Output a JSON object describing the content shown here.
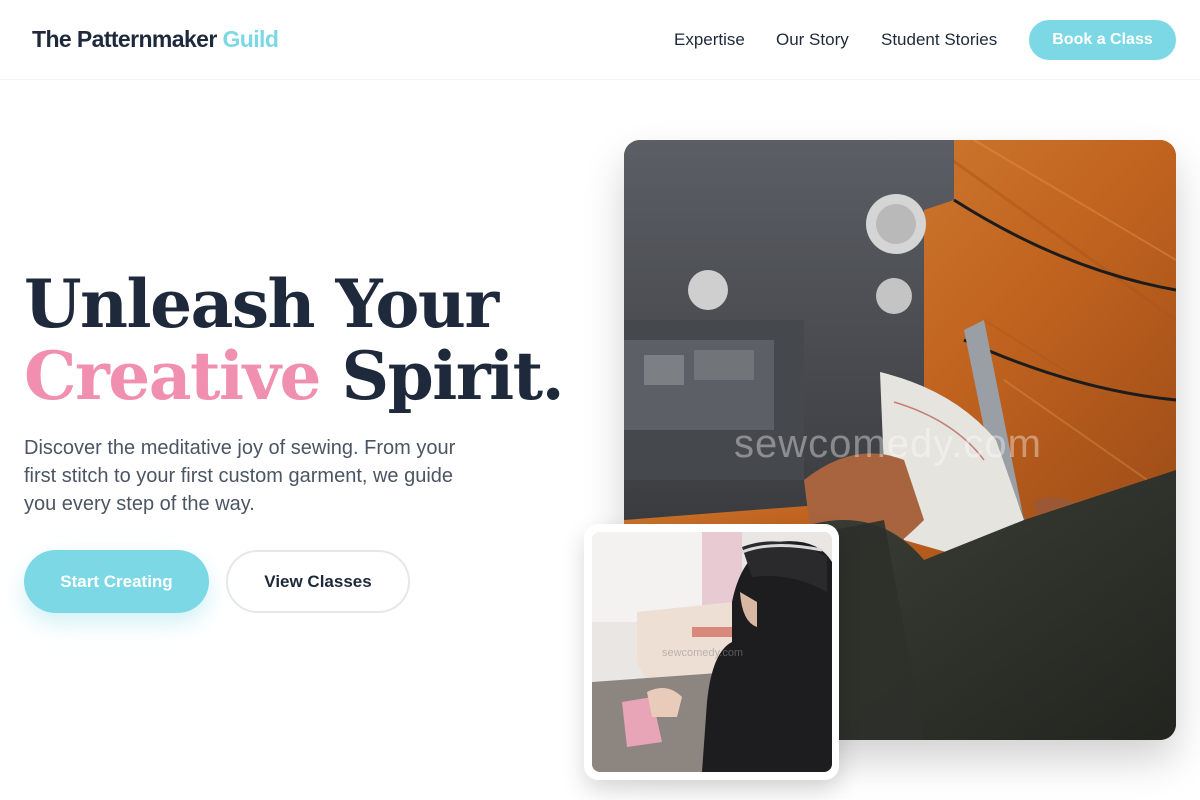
{
  "header": {
    "logo_main": "The Patternmaker",
    "logo_accent": "Guild",
    "nav": {
      "expertise": "Expertise",
      "story": "Our Story",
      "students": "Student Stories"
    },
    "cta": "Book a Class"
  },
  "hero": {
    "headline_line1": "Unleash Your",
    "headline_pink": "Creative",
    "headline_rest": "Spirit.",
    "subtext": "Discover the meditative joy of sewing. From your first stitch to your first custom garment, we guide you every step of the way.",
    "primary_button": "Start Creating",
    "secondary_button": "View Classes"
  },
  "images": {
    "main_watermark": "sewcomedy.com",
    "small_watermark": "sewcomedy.com"
  },
  "colors": {
    "accent_blue": "#7dd8e6",
    "accent_pink": "#f08fb0",
    "text_dark": "#1e293b",
    "text_muted": "#4b5563"
  }
}
